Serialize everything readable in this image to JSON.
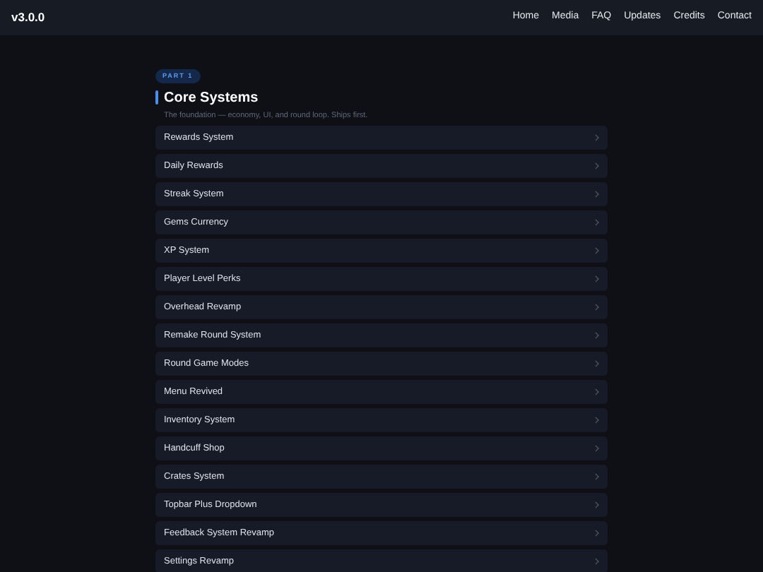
{
  "header": {
    "version": "v3.0.0",
    "nav": [
      "Home",
      "Media",
      "FAQ",
      "Updates",
      "Credits",
      "Contact"
    ]
  },
  "section": {
    "badge": "PART 1",
    "title": "Core Systems",
    "subtitle": "The foundation — economy, UI, and round loop. Ships first.",
    "items": [
      "Rewards System",
      "Daily Rewards",
      "Streak System",
      "Gems Currency",
      "XP System",
      "Player Level Perks",
      "Overhead Revamp",
      "Remake Round System",
      "Round Game Modes",
      "Menu Revived",
      "Inventory System",
      "Handcuff Shop",
      "Crates System",
      "Topbar Plus Dropdown",
      "Feedback System Revamp",
      "Settings Revamp"
    ]
  }
}
